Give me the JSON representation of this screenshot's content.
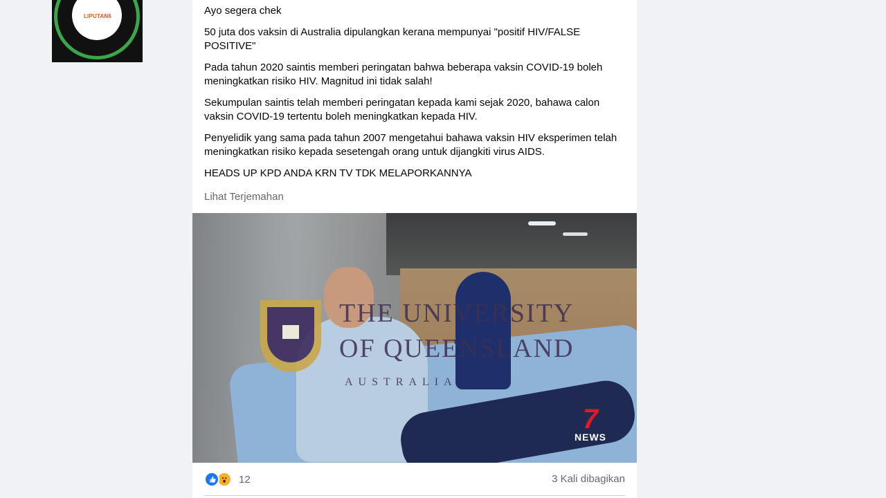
{
  "post": {
    "paragraphs": [
      "Ayo segera chek",
      "50 juta dos vaksin di Australia dipulangkan kerana mempunyai \"positif HIV/FALSE POSITIVE\"",
      "Pada tahun 2020 saintis memberi peringatan bahwa beberapa vaksin COVID-19 boleh meningkatkan risiko HIV.  Magnitud ini tidak salah!",
      "Sekumpulan saintis telah memberi peringatan kepada kami sejak 2020, bahawa calon vaksin COVID-19 tertentu boleh meningkatkan kepada HIV.",
      "Penyelidik yang sama pada tahun 2007 mengetahui bahawa vaksin HIV eksperimen telah meningkatkan risiko kepada sesetengah orang untuk dijangkiti virus AIDS.",
      "HEADS UP KPD ANDA KRN TV TDK MELAPORKANNYA"
    ],
    "translate_link": "Lihat Terjemahan"
  },
  "video": {
    "overlay_line1": "THE UNIVERSITY",
    "overlay_line2": "OF QUEENSLAND",
    "overlay_country": "AUSTRALIA",
    "news_number": "7",
    "news_label": "NEWS"
  },
  "watermark": {
    "logo_text": "LIPUTAN6"
  },
  "footer": {
    "reaction_count": "12",
    "shares": "3 Kali dibagikan",
    "reaction_icons": [
      "like-icon",
      "wow-icon"
    ]
  },
  "colors": {
    "background": "#f0f2f5",
    "card": "#ffffff",
    "secondary_text": "#65676b",
    "like_blue": "#1877f2",
    "wow_yellow": "#f7b125"
  }
}
